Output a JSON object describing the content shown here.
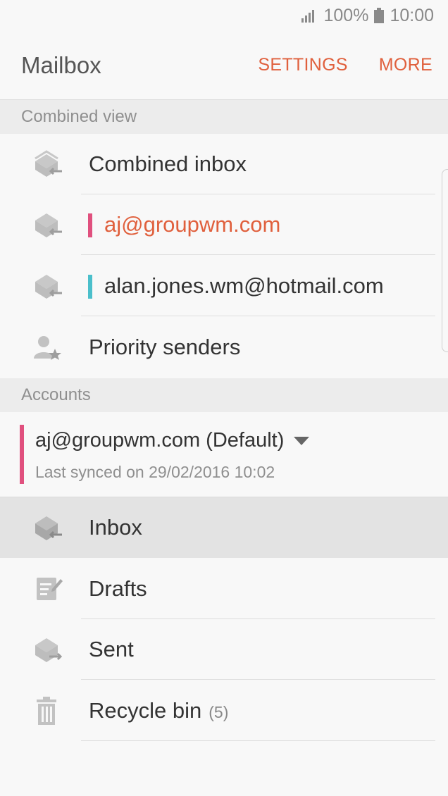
{
  "status": {
    "battery": "100%",
    "time": "10:00"
  },
  "appbar": {
    "title": "Mailbox",
    "settings": "SETTINGS",
    "more": "MORE"
  },
  "combined": {
    "header": "Combined view",
    "items": [
      {
        "label": "Combined inbox",
        "icon": "combined-inbox-icon"
      },
      {
        "label": "aj@groupwm.com",
        "icon": "inbox-icon",
        "color": "#e0507e",
        "text_color": "#e0603d"
      },
      {
        "label": "alan.jones.wm@hotmail.com",
        "icon": "inbox-icon",
        "color": "#4bbfcb"
      },
      {
        "label": "Priority senders",
        "icon": "priority-sender-icon"
      }
    ]
  },
  "accounts": {
    "header": "Accounts",
    "account": {
      "name": "aj@groupwm.com (Default)",
      "sync": "Last synced on 29/02/2016 10:02",
      "color": "#e0507e"
    },
    "folders": [
      {
        "label": "Inbox",
        "icon": "inbox-icon",
        "selected": true
      },
      {
        "label": "Drafts",
        "icon": "drafts-icon"
      },
      {
        "label": "Sent",
        "icon": "sent-icon"
      },
      {
        "label": "Recycle bin",
        "icon": "trash-icon",
        "count": "(5)"
      }
    ]
  },
  "colors": {
    "accent": "#e0603d",
    "account1": "#e0507e",
    "account2": "#4bbfcb"
  }
}
